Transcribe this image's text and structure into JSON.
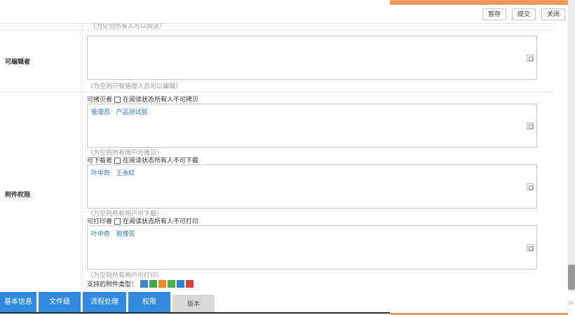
{
  "toolbar": {
    "save_draft": "暂存",
    "submit": "提交",
    "close": "关闭"
  },
  "top_hint": "（为空则所有人可以阅读）",
  "editors": {
    "label": "可编辑者",
    "hint": "（为空则只有管理人员可以编辑）"
  },
  "attach": {
    "label": "附件权限",
    "copy": {
      "title": "可拷贝者",
      "check_label": "在阅读状态所有人不可拷贝",
      "names": "管理员  产品测试部",
      "hint": "（为空则所有用户可拷贝）"
    },
    "download": {
      "title": "可下载者",
      "check_label": "在阅读状态所有人不可下载",
      "names": "叶中奇  王永红",
      "hint": "（为空则所有用户可下载）"
    },
    "print": {
      "title": "可打印者",
      "check_label": "在阅读状态所有人不可打印",
      "names": "叶中奇  管理员",
      "hint": "（为空则所有用户可打印）"
    },
    "types_label": "支持的附件类型：",
    "type_icons": [
      {
        "name": "image-file-icon",
        "color": "#3d86d6"
      },
      {
        "name": "excel-file-icon",
        "color": "#3cab4b"
      },
      {
        "name": "ppt-file-icon",
        "color": "#f08a2a"
      },
      {
        "name": "project-file-icon",
        "color": "#4bb04f"
      },
      {
        "name": "word-file-icon",
        "color": "#2f7fd3"
      },
      {
        "name": "pdf-file-icon",
        "color": "#e33a3a"
      }
    ]
  },
  "tabs": {
    "basic": "基本信息",
    "file_level": "文件级",
    "workflow": "流程处理",
    "permission": "权限",
    "version": "版本"
  },
  "colors": {
    "tab_blue": "#2f8ae0",
    "accent_orange": "#f29b5b",
    "name_blue": "#2c78c4"
  }
}
